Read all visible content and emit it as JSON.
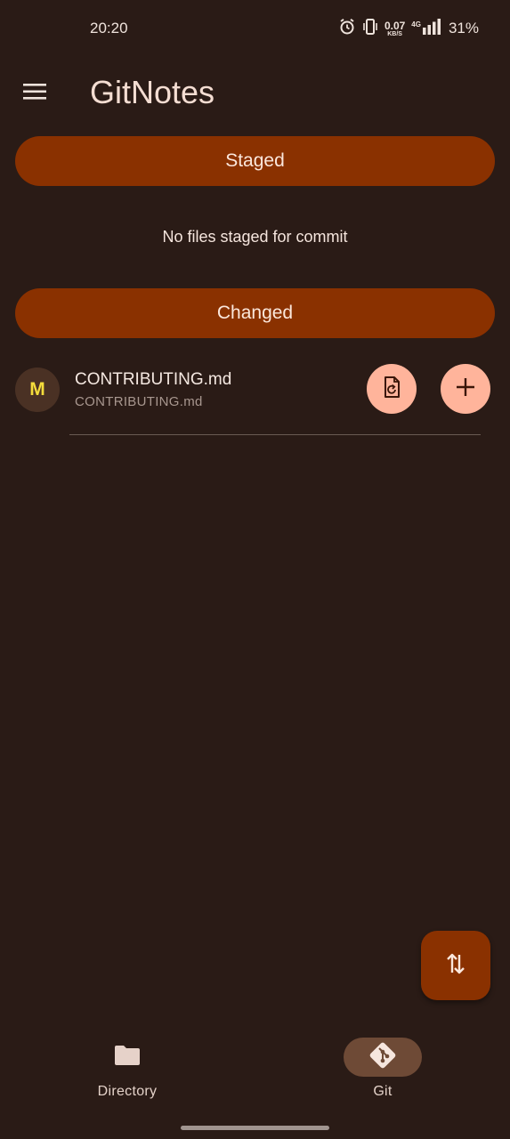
{
  "status_bar": {
    "time": "20:20",
    "net_speed": "0.07",
    "net_speed_unit": "KB/S",
    "network": "4G",
    "battery": "31%"
  },
  "app_bar": {
    "title": "GitNotes",
    "menu_icon": "hamburger-menu-icon"
  },
  "staged": {
    "header": "Staged",
    "empty_message": "No files staged for commit"
  },
  "changed": {
    "header": "Changed",
    "files": [
      {
        "status": "M",
        "name": "CONTRIBUTING.md",
        "path": "CONTRIBUTING.md",
        "actions": [
          "restore-file-icon",
          "add-icon"
        ]
      }
    ]
  },
  "fab": {
    "icon": "sync-arrows-icon"
  },
  "bottom_nav": {
    "items": [
      {
        "label": "Directory",
        "icon": "folder-icon",
        "active": false
      },
      {
        "label": "Git",
        "icon": "git-icon",
        "active": true
      }
    ]
  },
  "colors": {
    "background": "#2a1b16",
    "accent": "#8a3100",
    "button_light": "#ffb49b",
    "status_m": "#f4dc3c"
  }
}
